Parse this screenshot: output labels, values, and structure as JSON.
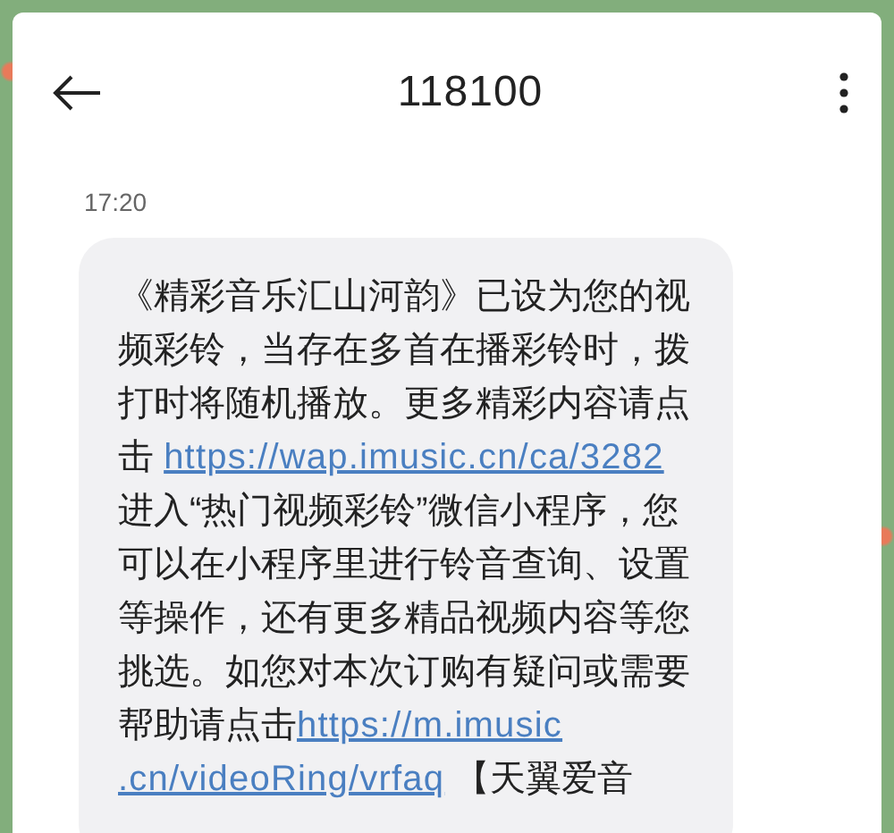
{
  "header": {
    "title": "118100"
  },
  "time": "17:20",
  "message": {
    "segments": [
      {
        "kind": "text",
        "text": "《精彩音乐汇山河韵》已设为您的视频彩铃，当存在多首在播彩铃时，拨打时将随机播放。更多精彩内容请点击 "
      },
      {
        "kind": "link",
        "text": "https://wap.imusic.cn/ca/3282"
      },
      {
        "kind": "text",
        "text": "进入“热门视频彩铃”微信小程序，您可以在小程序里进行铃音查询、设置等操作，还有更多精品视频内容等您挑选。如您对本次订购有疑问或需要帮助请点击"
      },
      {
        "kind": "link",
        "text": "https://m.imusic"
      },
      {
        "kind": "link",
        "text": ".cn/videoRing/vrfaq"
      },
      {
        "kind": "text",
        "text": " 【天翼爱音"
      }
    ]
  }
}
